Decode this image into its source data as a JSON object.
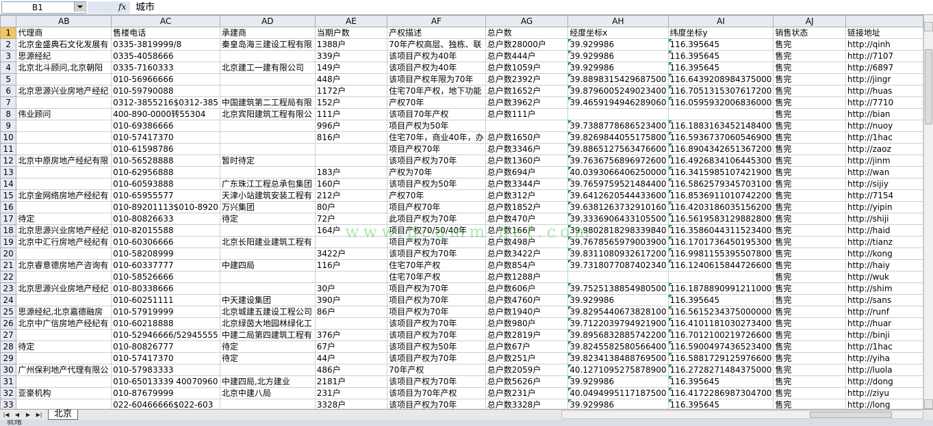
{
  "formula_bar": {
    "name_box": "B1",
    "fx": "fx",
    "content": "城市"
  },
  "columns": [
    "AB",
    "AC",
    "AD",
    "AE",
    "AF",
    "AG",
    "AH",
    "AI",
    "AJ",
    ""
  ],
  "rows": [
    [
      "1",
      "代理商",
      "售楼电话",
      "承建商",
      "当期户数",
      "产权描述",
      "总户数",
      "经度坐标x",
      "纬度坐标y",
      "销售状态",
      "链接地址"
    ],
    [
      "2",
      "北京金盛典石文化发展有",
      "0335-3819999/8",
      "秦皇岛海三建设工程有限",
      "1388户",
      "70年产权高层、独栋、联",
      "总户数28000户",
      "39.929986",
      "116.395645",
      "售完",
      "http://qinh"
    ],
    [
      "3",
      "思源经纪",
      "0335-4058666",
      "",
      "339户",
      "该项目产权为40年",
      "总户数444户",
      "39.929986",
      "116.395645",
      "售完",
      "http://7107"
    ],
    [
      "4",
      "北京北斗顾问,北京朝阳",
      "0335-7160333",
      "北京建工一建有限公司",
      "149户",
      "该项目产权为40年",
      "总户数1059户",
      "39.929986",
      "116.395645",
      "售完",
      "http://6897"
    ],
    [
      "5",
      "",
      "010-56966666",
      "",
      "448户",
      "该项目产权年限为70年",
      "总户数2392户",
      "39.8898315429687500",
      "116.6439208984375000",
      "售完",
      "http://jingr"
    ],
    [
      "6",
      "北京思源兴业房地产经纪",
      "010-59790088",
      "",
      "1172户",
      "住宅70年产权，地下功能",
      "总户数1652户",
      "39.8796005249023400",
      "116.7051315307617200",
      "售完",
      "http://huas"
    ],
    [
      "7",
      "",
      "0312-3855216$0312-385",
      "中国建筑第二工程局有限",
      "152户",
      "产权70年",
      "总户数3962户",
      "39.4659194946289060",
      "116.0595932006836000",
      "售完",
      "http://7710"
    ],
    [
      "8",
      "伟业顾问",
      "400-890-0000转55304",
      "北京宾阳建筑工程有限公",
      "111户",
      "该项目70年产权",
      "总户数111户",
      "",
      "",
      "售完",
      "http://bian"
    ],
    [
      "9",
      "",
      "010-69386666",
      "",
      "996户",
      "项目产权为50年",
      "",
      "39.7388778686523400",
      "116.1883163452148400",
      "售完",
      "http://nuoy"
    ],
    [
      "10",
      "",
      "010-57417370",
      "",
      "816户",
      "住宅70年，商业40年，办",
      "总户数1650户",
      "39.8269844055175800",
      "116.5936737060546900",
      "售完",
      "http://1hac"
    ],
    [
      "11",
      "",
      "010-61598786",
      "",
      "",
      "项目产权70年",
      "总户数3346户",
      "39.8865127563476600",
      "116.8904342651367200",
      "售完",
      "http://zaoz"
    ],
    [
      "12",
      "北京中原房地产经纪有限",
      "010-56528888",
      "暂时待定",
      "",
      "该项目产权为70年",
      "总户数1360户",
      "39.7636756896972600",
      "116.4926834106445300",
      "售完",
      "http://jinm"
    ],
    [
      "13",
      "",
      "010-62956888",
      "",
      "183户",
      "产权为70年",
      "总户数694户",
      "40.0393066406250000",
      "116.3415985107421900",
      "售完",
      "http://wan"
    ],
    [
      "14",
      "",
      "010-60593888",
      "广东珠江工程总承包集团",
      "160户",
      "该项目产权为50年",
      "总户数3344户",
      "39.7659759521484400",
      "116.5862579345703100",
      "售完",
      "http://sijiy"
    ],
    [
      "15",
      "北京金网络房地产经纪有",
      "010-65955577",
      "天津小站建筑安装工程有",
      "212户",
      "产权70年",
      "总户数312户",
      "39.6412620544433600",
      "116.8536911010742200",
      "售完",
      "http://7154"
    ],
    [
      "16",
      "",
      "010-89201113$010-8920",
      "万兴集团",
      "80户",
      "项目产权70年",
      "总户数1852户",
      "39.6381263732910160",
      "116.4203186035156200",
      "售完",
      "http://yipin"
    ],
    [
      "17",
      "待定",
      "010-80826633",
      "待定",
      "72户",
      "此项目产权为70年",
      "总户数470户",
      "39.3336906433105500",
      "116.5619583129882800",
      "售完",
      "http://shiji"
    ],
    [
      "18",
      "北京思源兴业房地产经纪",
      "010-82015588",
      "",
      "164户",
      "项目产权70/50/40年",
      "总户数166户",
      "39.9802818298339840",
      "116.3586044311523400",
      "售完",
      "http://haid"
    ],
    [
      "19",
      "北京中汇行房地产经纪有",
      "010-60306666",
      "北京长阳建业建筑工程有",
      "",
      "项目产权为70年",
      "总户数498户",
      "39.7678565979003900",
      "116.1701736450195300",
      "售完",
      "http://tianz"
    ],
    [
      "20",
      "",
      "010-58208999",
      "",
      "3422户",
      "该项目产权为70年",
      "总户数3422户",
      "39.8311080932617200",
      "116.9981155395507800",
      "售完",
      "http://kong"
    ],
    [
      "21",
      "北京睿意德房地产咨询有",
      "010-60337777",
      "中建四局",
      "116户",
      "住宅70年产权",
      "总户数854户",
      "39.7318077087402340",
      "116.1240615844726600",
      "售完",
      "http://haiy"
    ],
    [
      "22",
      "",
      "010-58526666",
      "",
      "",
      "住宅70年产权",
      "总户数1288户",
      "",
      "",
      "售完",
      "http://wuk"
    ],
    [
      "23",
      "北京思源兴业房地产经纪",
      "010-80338666",
      "",
      "30户",
      "项目产权为70年",
      "总户数606户",
      "39.7525138854980500",
      "116.1878890991211000",
      "售完",
      "http://shim"
    ],
    [
      "24",
      "",
      "010-60251111",
      "中天建设集团",
      "390户",
      "项目产权为70年",
      "总户数4760户",
      "39.929986",
      "116.395645",
      "售完",
      "http://sans"
    ],
    [
      "25",
      "思源经纪,北京嘉德融房",
      "010-57919999",
      "北京城建五建设工程公司",
      "86户",
      "项目产权为70年",
      "总户数1940户",
      "39.8295440673828100",
      "116.5615234375000000",
      "售完",
      "http://runf"
    ],
    [
      "26",
      "北京中广信房地产经纪有",
      "010-60218888",
      "北京绿茵大地园林绿化工",
      "",
      "该项目产权为70年",
      "总户数980户",
      "39.7122039794921900",
      "116.4101181030273400",
      "售完",
      "http://huar"
    ],
    [
      "27",
      "",
      "010-52946666/52945555",
      "中建二局第四建筑工程有",
      "376户",
      "该项目产权为70年",
      "总户数2819户",
      "39.8956832885742200",
      "116.7012100219726600",
      "售完",
      "http://binji"
    ],
    [
      "28",
      "待定",
      "010-80826777",
      "待定",
      "67户",
      "该项目产权为50年",
      "总户数67户",
      "39.8245582580566400",
      "116.5900497436523400",
      "售完",
      "http://1hac"
    ],
    [
      "29",
      "",
      "010-57417370",
      "待定",
      "44户",
      "该项目产权为70年",
      "总户数251户",
      "39.8234138488769500",
      "116.5881729125976600",
      "售完",
      "http://yiha"
    ],
    [
      "30",
      "广州保利地产代理有限公",
      "010-57983333",
      "",
      "486户",
      "70年产权",
      "总户数2059户",
      "40.1271095275878900",
      "116.2728271484375000",
      "售完",
      "http://luola"
    ],
    [
      "31",
      "",
      "010-65013339 40070960",
      "中建四局,北方建业",
      "2181户",
      "该项目产权为70年",
      "总户数5626户",
      "39.929986",
      "116.395645",
      "售完",
      "http://dong"
    ],
    [
      "32",
      "亚豪机构",
      "010-87679999",
      "北京中建八局",
      "231户",
      "该项目为70年产权",
      "总户数231户",
      "40.0494995117187500",
      "116.4172286987304700",
      "售完",
      "http://ziyu"
    ],
    [
      "33",
      "",
      "022-60466666$022-603",
      "",
      "3328户",
      "该项目产权为70年",
      "总户数3328户",
      "39.929986",
      "116.395645",
      "售完",
      "http://long"
    ]
  ],
  "watermark": "www.pcqmm.net.com",
  "sheet_tab": "北京",
  "status": "就绪"
}
